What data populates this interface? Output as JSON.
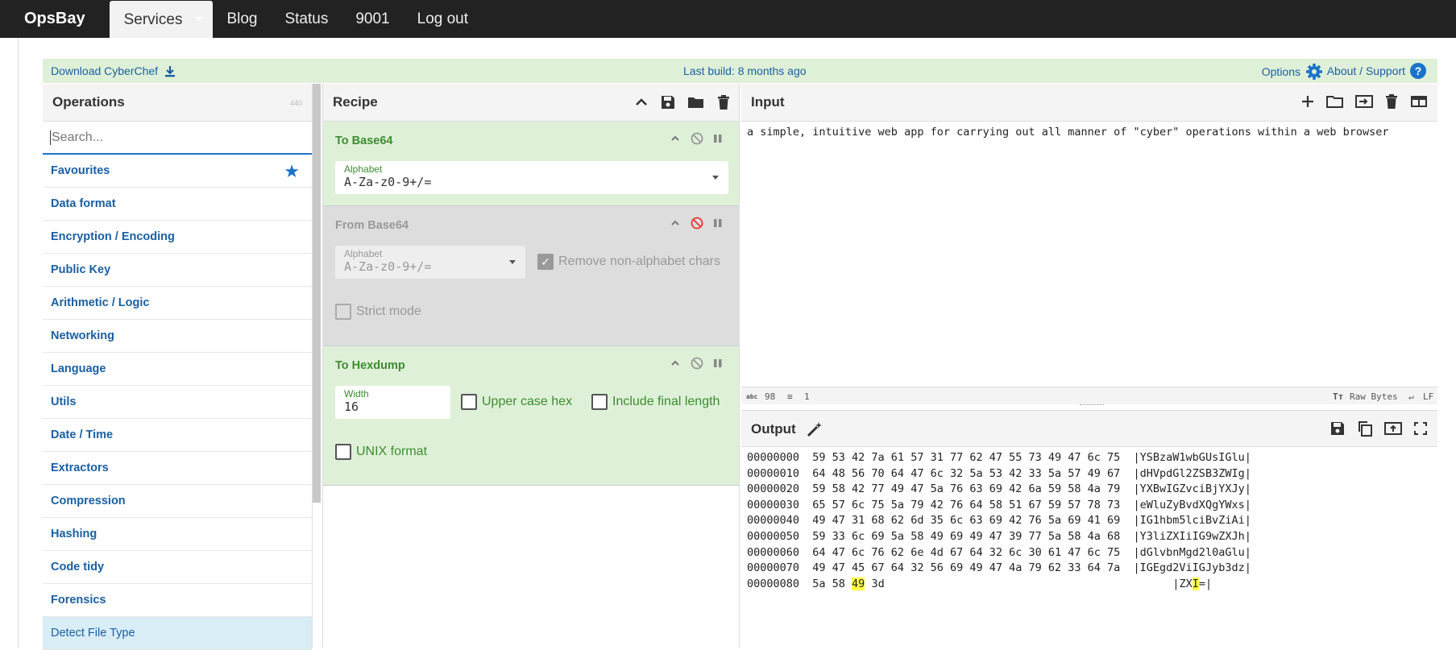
{
  "nav": {
    "brand": "OpsBay",
    "items": [
      "Services",
      "Blog",
      "Status",
      "9001",
      "Log out"
    ]
  },
  "banner": {
    "download": "Download CyberChef",
    "build": "Last build: 8 months ago",
    "options": "Options",
    "about": "About / Support",
    "bg_color": "#dff0d8",
    "link_color": "#1a5fa3"
  },
  "operations": {
    "title": "Operations",
    "count": "440",
    "search_placeholder": "Search...",
    "categories": [
      "Favourites",
      "Data format",
      "Encryption / Encoding",
      "Public Key",
      "Arithmetic / Logic",
      "Networking",
      "Language",
      "Utils",
      "Date / Time",
      "Extractors",
      "Compression",
      "Hashing",
      "Code tidy",
      "Forensics"
    ],
    "selected_op": "Detect File Type"
  },
  "recipe": {
    "title": "Recipe",
    "ops": [
      {
        "name": "To Base64",
        "alphabet_label": "Alphabet",
        "alphabet": "A-Za-z0-9+/="
      },
      {
        "name": "From Base64",
        "alphabet_label": "Alphabet",
        "alphabet": "A-Za-z0-9+/=",
        "remove": "Remove non-alphabet chars",
        "strict": "Strict mode"
      },
      {
        "name": "To Hexdump",
        "width_label": "Width",
        "width": "16",
        "upper": "Upper case hex",
        "final": "Include final length",
        "unix": "UNIX format"
      }
    ]
  },
  "input": {
    "title": "Input",
    "text": "a simple, intuitive web app for carrying out all manner of \"cyber\" operations within a web browser",
    "chars_icon": "abc",
    "chars": "98",
    "lines": "1",
    "raw": "Raw Bytes",
    "eol": "LF"
  },
  "output": {
    "title": "Output",
    "lines": [
      "00000000  59 53 42 7a 61 57 31 77 62 47 55 73 49 47 6c 75  |YSBzaW1wbGUsIGlu|",
      "00000010  64 48 56 70 64 47 6c 32 5a 53 42 33 5a 57 49 67  |dHVpdGl2ZSB3ZWIg|",
      "00000020  59 58 42 77 49 47 5a 76 63 69 42 6a 59 58 4a 79  |YXBwIGZvciBjYXJy|",
      "00000030  65 57 6c 75 5a 79 42 76 64 58 51 67 59 57 78 73  |eWluZyBvdXQgYWxs|",
      "00000040  49 47 31 68 62 6d 35 6c 63 69 42 76 5a 69 41 69  |IG1hbm5lciBvZiAi|",
      "00000050  59 33 6c 69 5a 58 49 69 49 47 39 77 5a 58 4a 68  |Y3liZXIiIG9wZXJh|",
      "00000060  64 47 6c 76 62 6e 4d 67 64 32 6c 30 61 47 6c 75  |dGlvbnMgd2l0aGlu|",
      "00000070  49 47 45 67 64 32 56 69 49 47 4a 79 62 33 64 7a  |IGEgd2ViIGJyb3dz|"
    ],
    "last_line_pre": "00000080  5a 58 ",
    "last_line_hl1": "49",
    "last_line_mid": " 3d                                            |ZX",
    "last_line_hl2": "I",
    "last_line_post": "=|"
  }
}
